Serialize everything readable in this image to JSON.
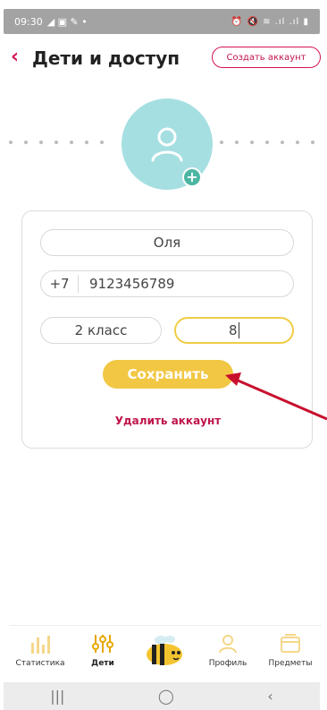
{
  "status_bar": {
    "time": "09:30",
    "icons_left": "◢ ▣ ✎ •",
    "icons_right": "⏰ 🔇 ≋ .ıl .ıl ▮"
  },
  "header": {
    "back_icon": "‹",
    "title": "Дети и доступ",
    "create_account_label": "Создать аккаунт"
  },
  "form": {
    "name_value": "Оля",
    "phone_code": "+7",
    "phone_value": "9123456789",
    "grade_value": "2 класс",
    "letter_value": "8",
    "save_label": "Сохранить",
    "delete_label": "Удалить аккаунт"
  },
  "bottom_nav": {
    "items": [
      {
        "label": "Статистика",
        "icon": "bar-chart-icon"
      },
      {
        "label": "Дети",
        "icon": "sliders-icon"
      },
      {
        "label": "",
        "icon": "bee-mascot-icon"
      },
      {
        "label": "Профиль",
        "icon": "person-icon"
      },
      {
        "label": "Предметы",
        "icon": "folder-icon"
      }
    ]
  },
  "system_nav": {
    "recents": "|||",
    "home": "◯",
    "back": "‹"
  },
  "colors": {
    "accent": "#d3144f",
    "yellow": "#f2c743",
    "avatar_bg": "#a6dfe2",
    "annotation_arrow": "#c8102e"
  }
}
